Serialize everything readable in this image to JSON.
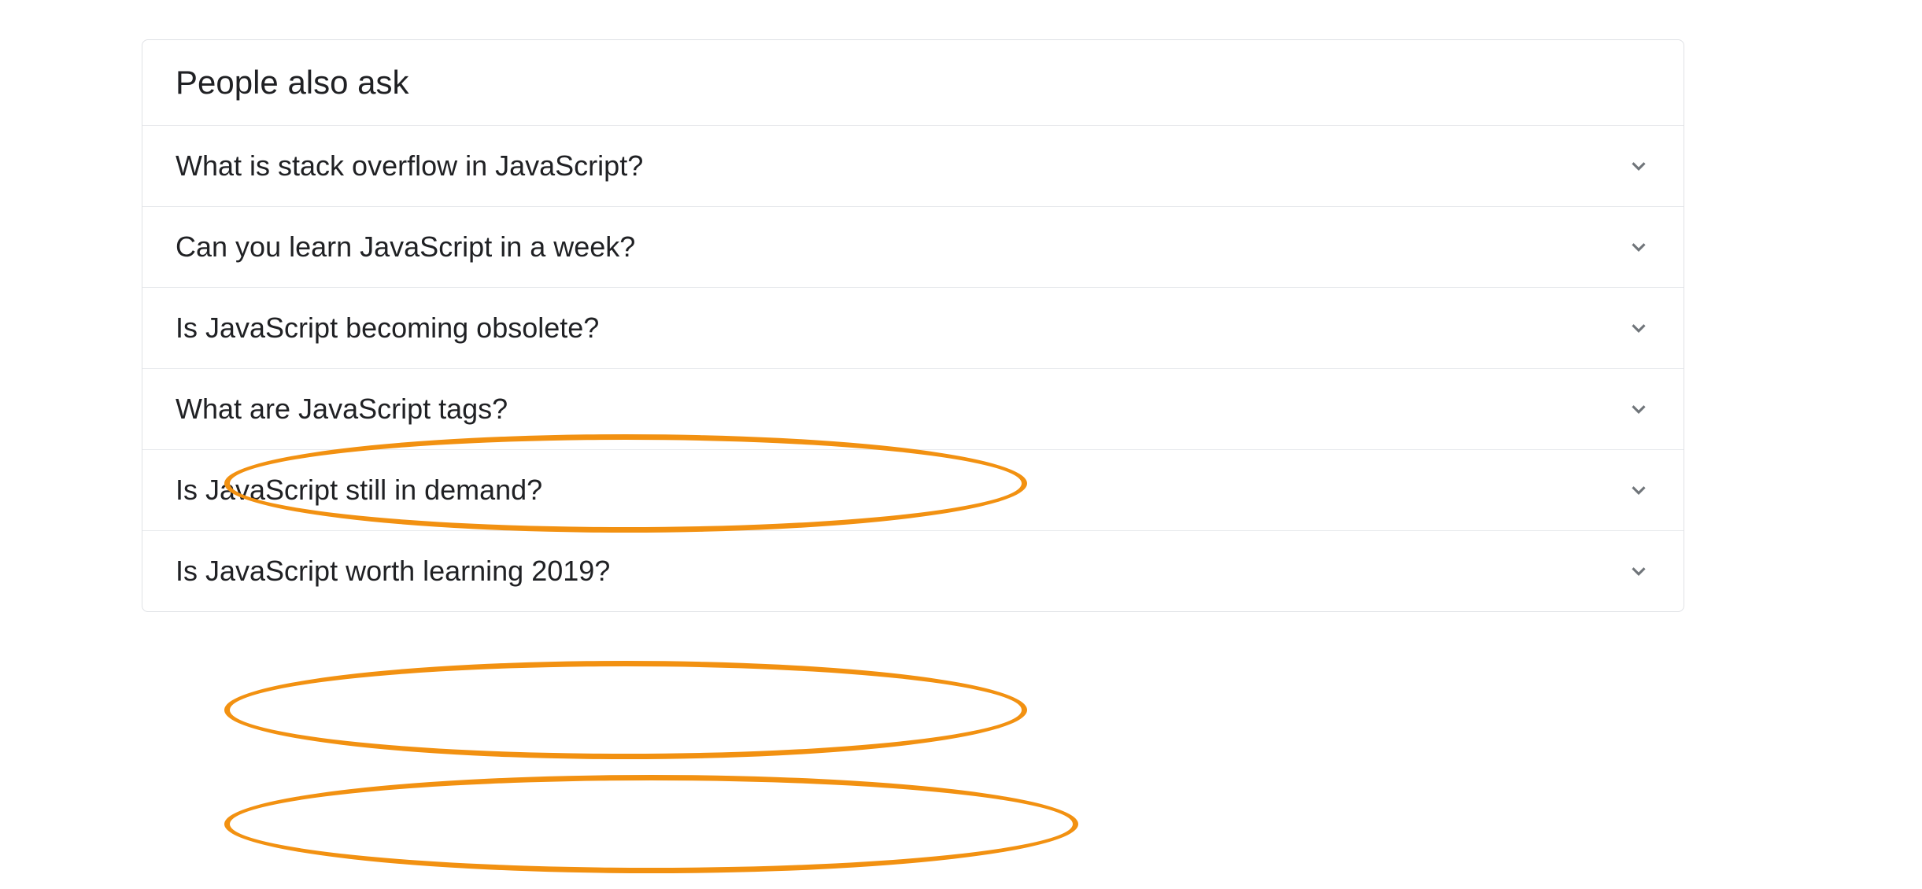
{
  "paa": {
    "header": "People also ask",
    "questions": [
      {
        "text": "What is stack overflow in JavaScript?",
        "highlighted": false
      },
      {
        "text": "Can you learn JavaScript in a week?",
        "highlighted": false
      },
      {
        "text": "Is JavaScript becoming obsolete?",
        "highlighted": true
      },
      {
        "text": "What are JavaScript tags?",
        "highlighted": false
      },
      {
        "text": "Is JavaScript still in demand?",
        "highlighted": true
      },
      {
        "text": "Is JavaScript worth learning 2019?",
        "highlighted": true
      }
    ]
  },
  "annotation": {
    "color": "#f29111"
  }
}
